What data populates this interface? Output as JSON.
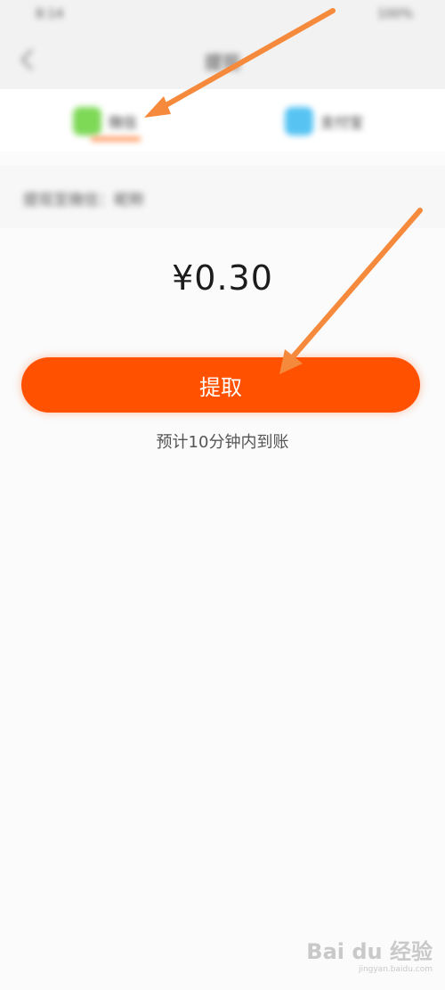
{
  "status_bar": {
    "left": "8:14",
    "right": "100%"
  },
  "header": {
    "title": "提现"
  },
  "tabs": [
    {
      "label": "微信",
      "active": true
    },
    {
      "label": "支付宝",
      "active": false
    }
  ],
  "info": {
    "text": "提现至微信：昵称"
  },
  "balance": {
    "amount": "¥0.30"
  },
  "actions": {
    "withdraw_label": "提取"
  },
  "hint": {
    "eta": "预计10分钟内到账"
  },
  "watermark": {
    "main": "Bai du 经验",
    "sub": "jingyan.baidu.com"
  },
  "colors": {
    "accent": "#ff5100",
    "arrow": "#f58a3c",
    "tab_underline": "#ff7a2e"
  }
}
